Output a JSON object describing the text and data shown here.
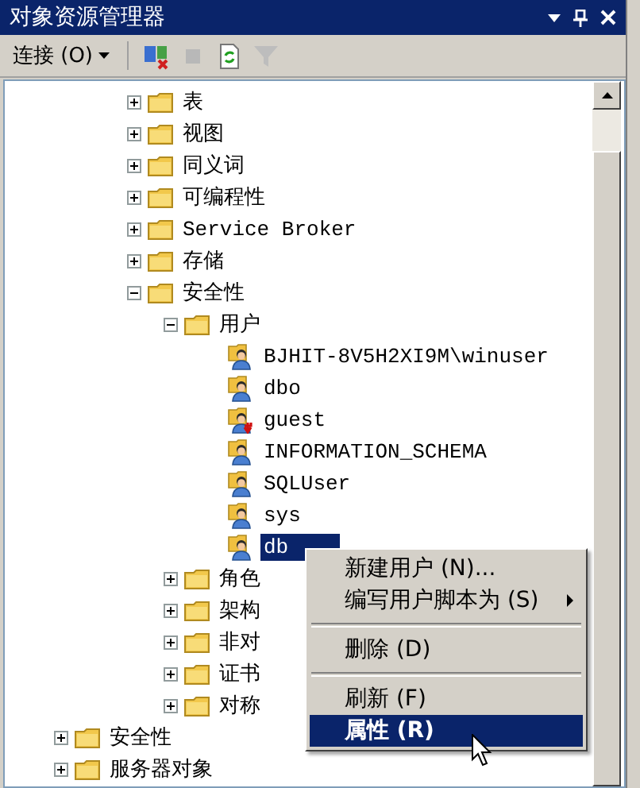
{
  "window": {
    "title": "对象资源管理器"
  },
  "toolbar": {
    "connect": {
      "label": "连接 (O)"
    },
    "icons": [
      {
        "kind": "disconnect",
        "disabled": false
      },
      {
        "kind": "stop",
        "disabled": true
      },
      {
        "kind": "refresh",
        "disabled": false
      },
      {
        "kind": "filter",
        "disabled": true
      }
    ]
  },
  "tree": {
    "nodes": [
      {
        "children": [
          {
            "children": [
              {
                "label": "表",
                "kind": "folder",
                "expanded": false
              },
              {
                "label": "视图",
                "kind": "folder",
                "expanded": false
              },
              {
                "label": "同义词",
                "kind": "folder",
                "expanded": false
              },
              {
                "label": "可编程性",
                "kind": "folder",
                "expanded": false
              },
              {
                "label": "Service Broker",
                "kind": "folder",
                "expanded": false
              },
              {
                "label": "存储",
                "kind": "folder",
                "expanded": false
              },
              {
                "label": "安全性",
                "kind": "folder",
                "expanded": true,
                "children": [
                  {
                    "label": "用户",
                    "kind": "folder",
                    "expanded": true,
                    "children": [
                      {
                        "label": "BJHIT-8V5H2XI9M\\winuser",
                        "kind": "user",
                        "disabled": false,
                        "selected": false
                      },
                      {
                        "label": "dbo",
                        "kind": "user",
                        "disabled": false,
                        "selected": false
                      },
                      {
                        "label": "guest",
                        "kind": "user",
                        "disabled": true,
                        "selected": false
                      },
                      {
                        "label": "INFORMATION_SCHEMA",
                        "kind": "user",
                        "disabled": false,
                        "selected": false
                      },
                      {
                        "label": "SQLUser",
                        "kind": "user",
                        "disabled": false,
                        "selected": false
                      },
                      {
                        "label": "sys",
                        "kind": "user",
                        "disabled": false,
                        "selected": false
                      },
                      {
                        "label": "db",
                        "kind": "user",
                        "disabled": false,
                        "selected": true
                      }
                    ]
                  },
                  {
                    "label": "角色",
                    "kind": "folder",
                    "expanded": false
                  },
                  {
                    "label": "架构",
                    "kind": "folder",
                    "expanded": false
                  },
                  {
                    "label": "非对",
                    "kind": "folder",
                    "expanded": false
                  },
                  {
                    "label": "证书",
                    "kind": "folder",
                    "expanded": false
                  },
                  {
                    "label": "对称",
                    "kind": "folder",
                    "expanded": false
                  }
                ]
              }
            ]
          }
        ]
      },
      {
        "label": "安全性",
        "kind": "folder",
        "expanded": false
      },
      {
        "label": "服务器对象",
        "kind": "folder",
        "expanded": false
      }
    ]
  },
  "context_menu": {
    "items": [
      {
        "kind": "item",
        "label": "新建用户 (N)...",
        "submenu": false,
        "selected": false
      },
      {
        "kind": "item",
        "label": "编写用户脚本为 (S)",
        "submenu": true,
        "selected": false
      },
      {
        "kind": "separator"
      },
      {
        "kind": "item",
        "label": "删除 (D)",
        "submenu": false,
        "selected": false
      },
      {
        "kind": "separator"
      },
      {
        "kind": "item",
        "label": "刷新 (F)",
        "submenu": false,
        "selected": false
      },
      {
        "kind": "item",
        "label": "属性 (R)",
        "submenu": false,
        "selected": true
      }
    ]
  }
}
